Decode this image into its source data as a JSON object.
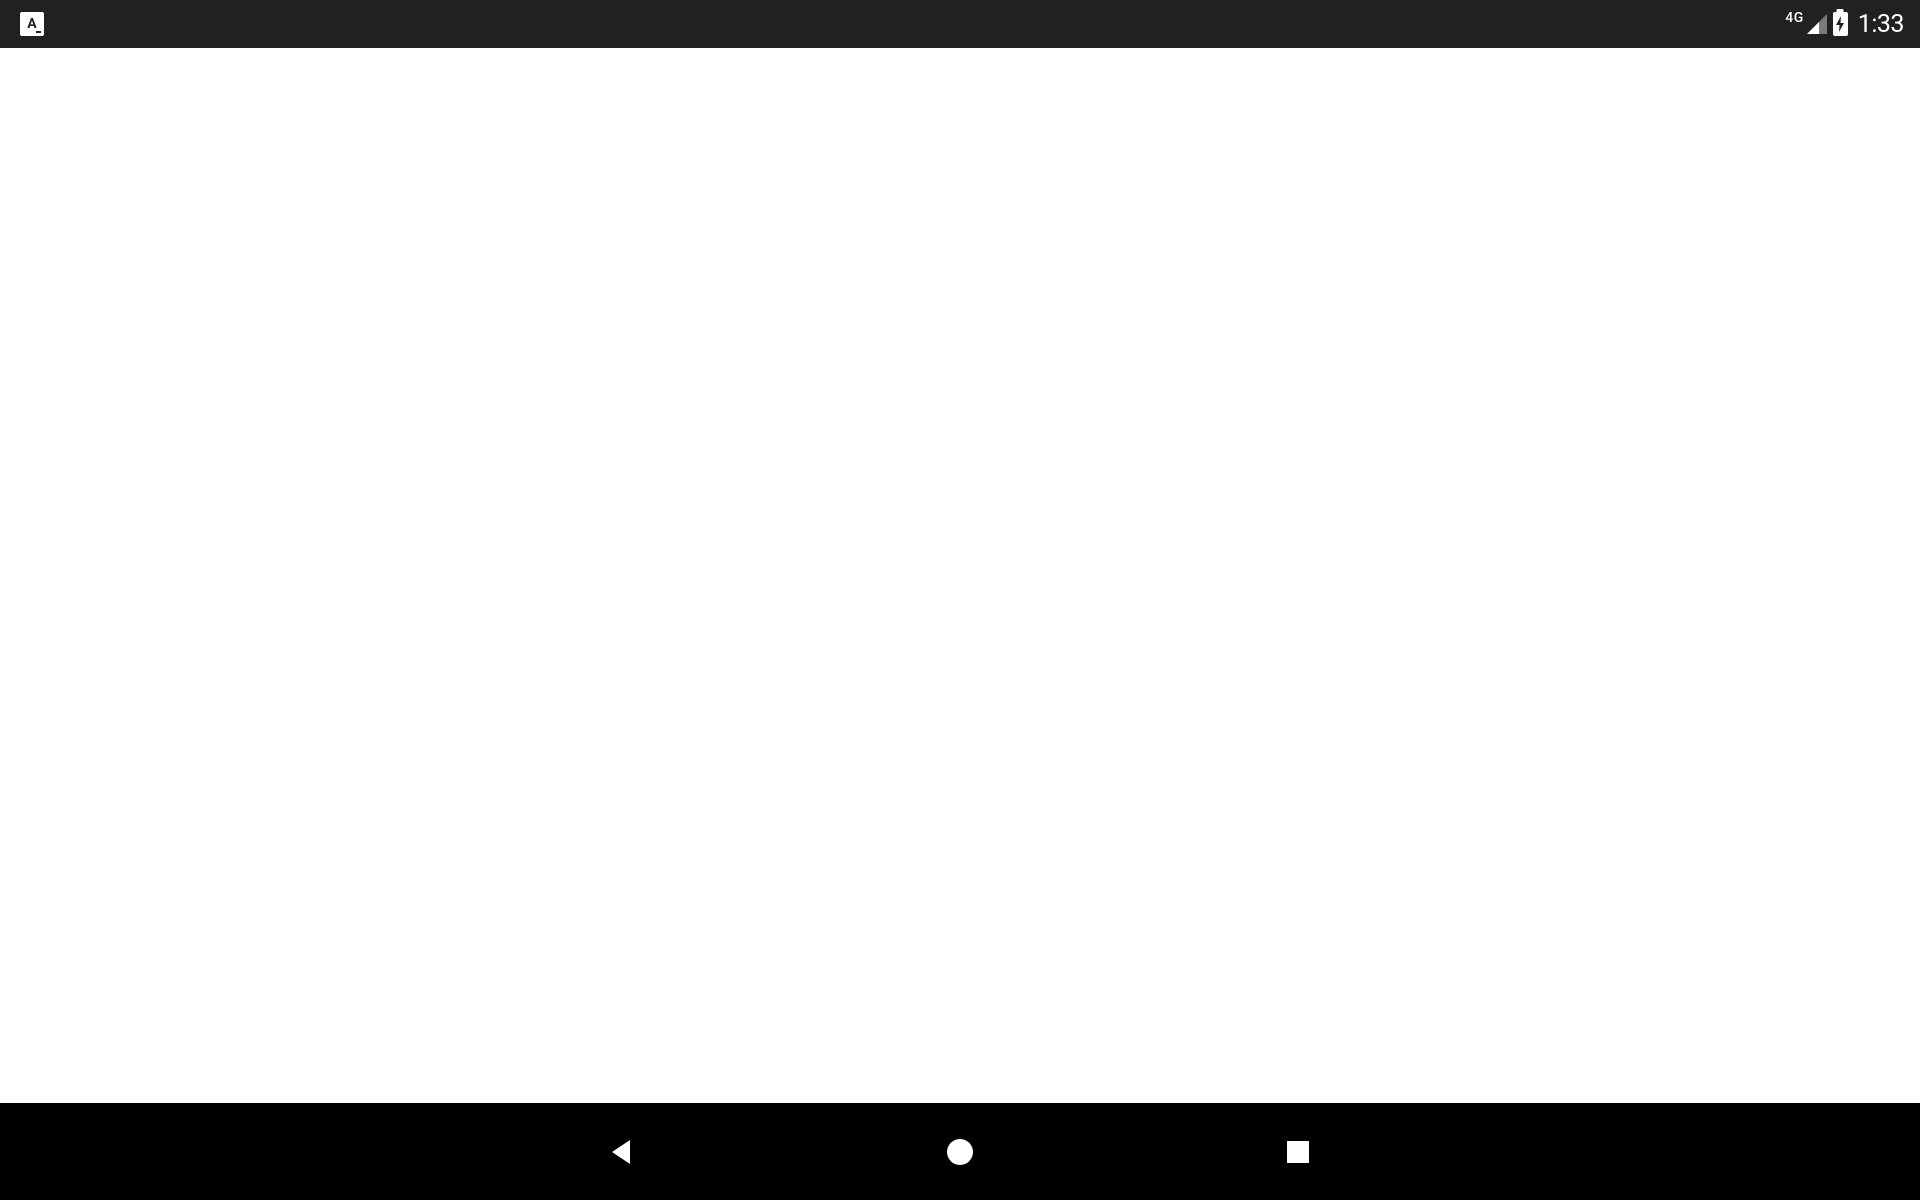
{
  "status_bar": {
    "keyboard_indicator": "A",
    "network_type": "4G",
    "time": "1:33"
  },
  "icons": {
    "keyboard": "keyboard-language-icon",
    "signal": "cellular-signal-icon",
    "battery": "battery-charging-icon",
    "nav_back": "back-triangle-icon",
    "nav_home": "home-circle-icon",
    "nav_recent": "recent-apps-square-icon"
  }
}
